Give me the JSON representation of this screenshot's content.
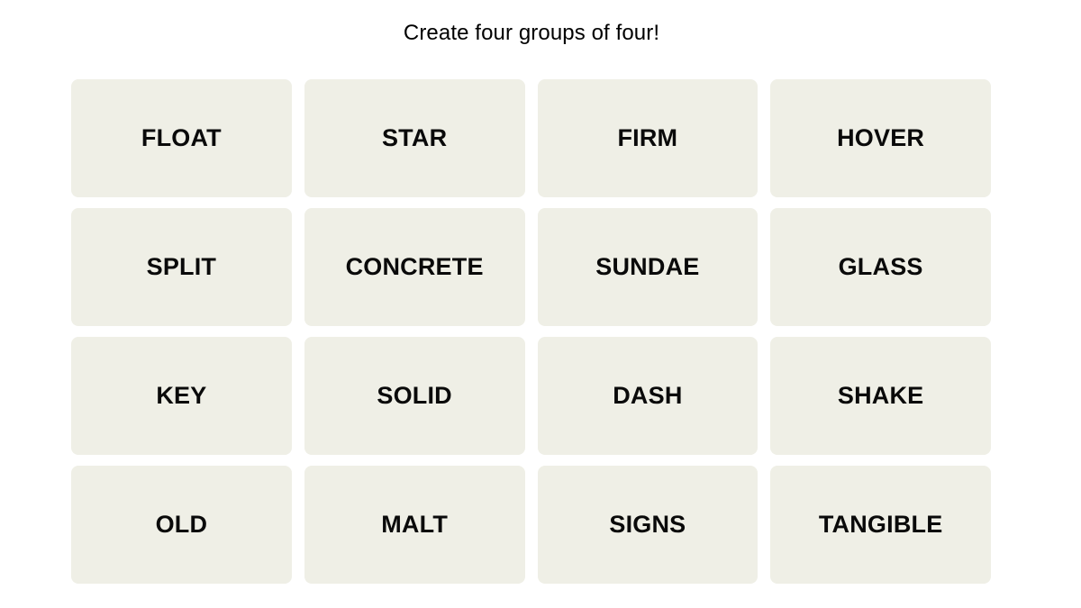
{
  "page": {
    "background_color": "#ffffff",
    "title": "Create four groups of four!"
  },
  "theme": {
    "tile_background": "#efefe6",
    "tile_text_color": "#0a0a0a",
    "title_color": "#000000"
  },
  "grid": {
    "rows": 4,
    "columns": 4,
    "tiles": [
      {
        "label": "FLOAT"
      },
      {
        "label": "STAR"
      },
      {
        "label": "FIRM"
      },
      {
        "label": "HOVER"
      },
      {
        "label": "SPLIT"
      },
      {
        "label": "CONCRETE"
      },
      {
        "label": "SUNDAE"
      },
      {
        "label": "GLASS"
      },
      {
        "label": "KEY"
      },
      {
        "label": "SOLID"
      },
      {
        "label": "DASH"
      },
      {
        "label": "SHAKE"
      },
      {
        "label": "OLD"
      },
      {
        "label": "MALT"
      },
      {
        "label": "SIGNS"
      },
      {
        "label": "TANGIBLE"
      }
    ]
  }
}
